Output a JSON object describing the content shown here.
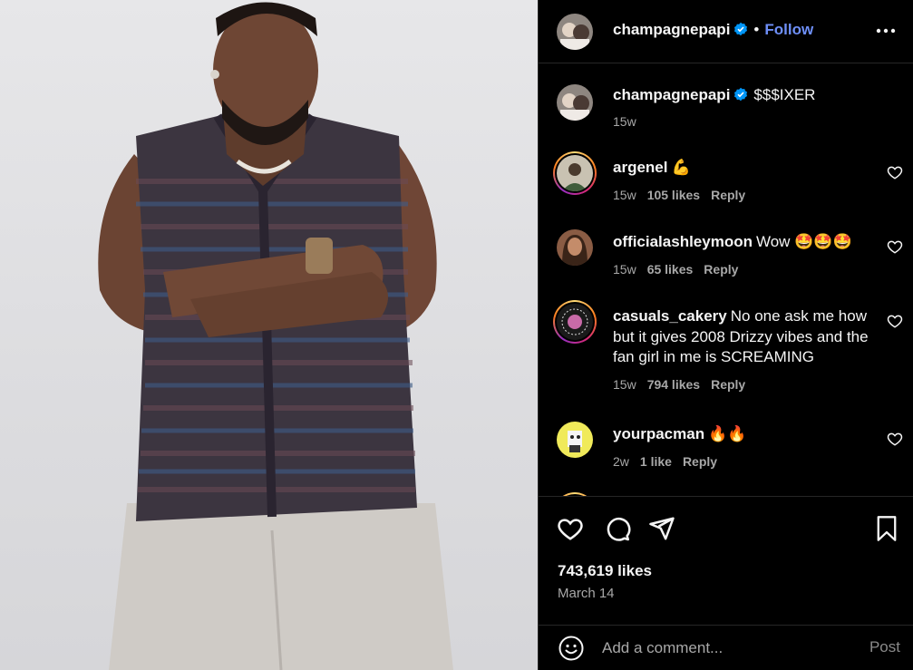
{
  "header": {
    "username": "champagnepapi",
    "separator": "•",
    "follow_label": "Follow"
  },
  "caption": {
    "username": "champagnepapi",
    "text": "$$$IXER",
    "time": "15w"
  },
  "comments": [
    {
      "username": "argenel",
      "text": "💪",
      "time": "15w",
      "likes": "105 likes",
      "reply": "Reply"
    },
    {
      "username": "officialashleymoon",
      "text": "Wow 🤩🤩🤩",
      "time": "15w",
      "likes": "65 likes",
      "reply": "Reply"
    },
    {
      "username": "casuals_cakery",
      "text": "No one ask me how but it gives 2008 Drizzy vibes and the fan girl in me is SCREAMING",
      "time": "15w",
      "likes": "794 likes",
      "reply": "Reply"
    },
    {
      "username": "yourpacman",
      "text": "🔥🔥",
      "time": "2w",
      "likes": "1 like",
      "reply": "Reply"
    }
  ],
  "post": {
    "likes": "743,619 likes",
    "date": "March 14"
  },
  "comment_box": {
    "placeholder": "Add a comment...",
    "post_label": "Post"
  },
  "colors": {
    "background": "#000000",
    "accent_blue": "#6e8ff8",
    "verified_blue": "#0095f6",
    "muted": "#a8a8a8"
  },
  "icons": [
    "verified-icon",
    "more-options-icon",
    "heart-icon",
    "comment-icon",
    "share-icon",
    "save-icon",
    "emoji-icon"
  ]
}
